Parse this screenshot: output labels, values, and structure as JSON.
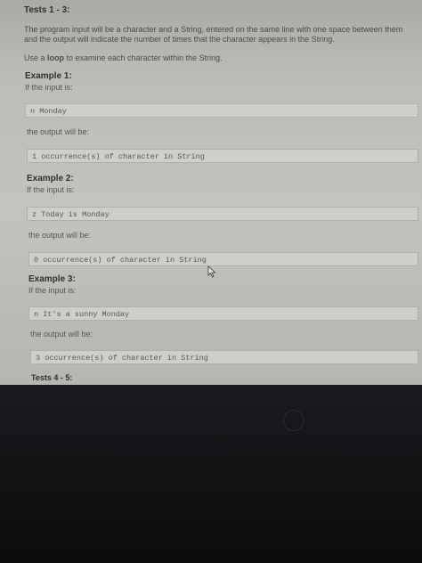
{
  "tests_header": "Tests 1 - 3:",
  "description": "The program input will be a character and a String, entered on the same line with one space between them and the output will indicate the number of times that the character appears in the String.",
  "hint": {
    "before": "Use a ",
    "bold": "loop",
    "after": " to examine each character within the String."
  },
  "input_label": "If the input is:",
  "output_label": "the output will be:",
  "examples": [
    {
      "title": "Example 1:",
      "input": "n Monday",
      "output": "1 occurrence(s) of character in String"
    },
    {
      "title": "Example 2:",
      "input": "z Today is Monday",
      "output": "0 occurrence(s) of character in String"
    },
    {
      "title": "Example 3:",
      "input": "n It's a sunny Monday",
      "output": "3 occurrence(s) of character in String"
    }
  ],
  "next_tests": "Tests 4 - 5:",
  "icons": {
    "cursor": "mouse-pointer-icon",
    "logo": "hp-logo-icon"
  }
}
